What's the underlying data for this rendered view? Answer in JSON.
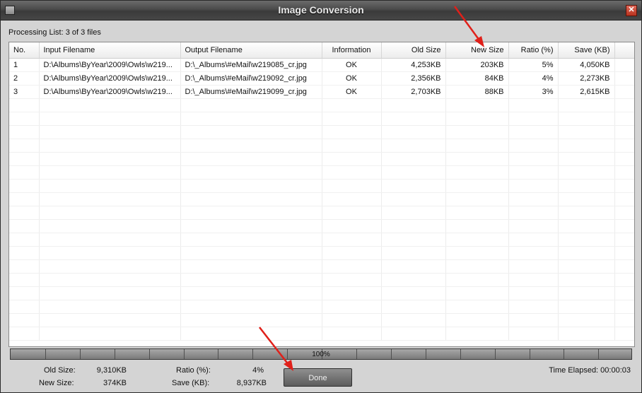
{
  "window": {
    "title": "Image Conversion",
    "close_glyph": "✕"
  },
  "processing_label": "Processing List: 3 of 3 files",
  "table": {
    "columns": [
      "No.",
      "Input Filename",
      "Output Filename",
      "Information",
      "Old Size",
      "New Size",
      "Ratio (%)",
      "Save (KB)"
    ],
    "rows": [
      [
        "1",
        "D:\\Albums\\ByYear\\2009\\Owls\\w219...",
        "D:\\_Albums\\#eMail\\w219085_cr.jpg",
        "OK",
        "4,253KB",
        "203KB",
        "5%",
        "4,050KB"
      ],
      [
        "2",
        "D:\\Albums\\ByYear\\2009\\Owls\\w219...",
        "D:\\_Albums\\#eMail\\w219092_cr.jpg",
        "OK",
        "2,356KB",
        "84KB",
        "4%",
        "2,273KB"
      ],
      [
        "3",
        "D:\\Albums\\ByYear\\2009\\Owls\\w219...",
        "D:\\_Albums\\#eMail\\w219099_cr.jpg",
        "OK",
        "2,703KB",
        "88KB",
        "3%",
        "2,615KB"
      ]
    ],
    "empty_rows": 18
  },
  "progress": {
    "value": 1.0,
    "label": "100%"
  },
  "summary": {
    "old_size_label": "Old Size:",
    "old_size_value": "9,310KB",
    "new_size_label": "New Size:",
    "new_size_value": "374KB",
    "ratio_label": "Ratio (%):",
    "ratio_value": "4%",
    "save_label": "Save (KB):",
    "save_value": "8,937KB",
    "time_elapsed": "Time Elapsed: 00:00:03"
  },
  "done_label": "Done",
  "colors": {
    "annotation_arrow": "#e0201a"
  }
}
